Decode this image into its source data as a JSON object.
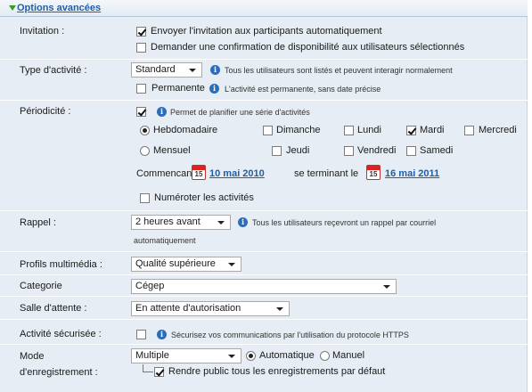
{
  "section_title": "Options avancées",
  "invitation": {
    "label": "Invitation :",
    "send_auto": "Envoyer l'invitation aux participants automatiquement",
    "ask_confirm": "Demander une confirmation de disponibilité aux utilisateurs sélectionnés",
    "send_auto_checked": true,
    "ask_confirm_checked": false
  },
  "activity_type": {
    "label": "Type d'activité :",
    "value": "Standard",
    "info": "Tous les utilisateurs sont listés et peuvent interagir normalement",
    "permanent_label": "Permanente",
    "permanent_info": "L'activité est permanente, sans date précise"
  },
  "periodicity": {
    "label": "Périodicité :",
    "enabled": true,
    "info": "Permet de planifier une série d'activités",
    "weekly": "Hebdomadaire",
    "monthly": "Mensuel",
    "days": {
      "sunday": "Dimanche",
      "monday": "Lundi",
      "tuesday": "Mardi",
      "wednesday": "Mercredi",
      "thursday": "Jeudi",
      "friday": "Vendredi",
      "saturday": "Samedi"
    },
    "tuesday_checked": true,
    "starting": "Commencant le",
    "start_date": "10 mai 2010",
    "ending": "se terminant le",
    "end_date": "16 mai 2011",
    "calendar_day": "15",
    "number_label": "Numéroter les activités"
  },
  "reminder": {
    "label": "Rappel :",
    "value": "2 heures avant",
    "info_line1": "Tous les utilisateurs reçevront un rappel par courriel",
    "info_line2": "automatiquement"
  },
  "profiles": {
    "label": "Profils multimédia :",
    "value": "Qualité supérieure"
  },
  "category": {
    "label": "Categorie",
    "value": "Cégep"
  },
  "waiting_room": {
    "label": "Salle d'attente :",
    "value": "En attente d'autorisation"
  },
  "secure": {
    "label": "Activité sécurisée :",
    "info": "Sécurisez vos communications par l'utilisation du protocole HTTPS"
  },
  "recording": {
    "label_line1": "Mode",
    "label_line2": "d'enregistrement :",
    "value": "Multiple",
    "automatic": "Automatique",
    "manual": "Manuel",
    "public_label": "Rendre public tous les enregistrements par défaut",
    "public_checked": true
  },
  "icons": {
    "info": "info-icon",
    "calendar": "calendar-icon",
    "expand": "expand-triangle-icon"
  },
  "colors": {
    "link": "#1f5fa8",
    "panel_bg": "#e6edf4",
    "info": "#2b6db8"
  }
}
